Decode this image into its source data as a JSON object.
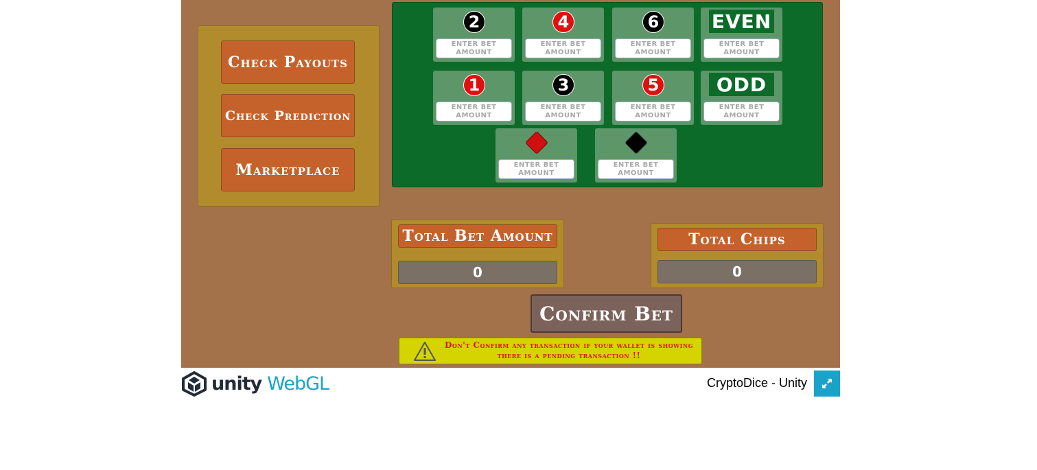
{
  "menu": {
    "check_payouts": "Check Payouts",
    "check_prediction": "Check Prediction",
    "marketplace": "Marketplace"
  },
  "board": {
    "bet_placeholder": "ENTER BET AMOUNT",
    "cells": [
      {
        "id": "2",
        "label": "2",
        "kind": "chip",
        "color": "black"
      },
      {
        "id": "4",
        "label": "4",
        "kind": "chip",
        "color": "red"
      },
      {
        "id": "6",
        "label": "6",
        "kind": "chip",
        "color": "black"
      },
      {
        "id": "even",
        "label": "EVEN",
        "kind": "text",
        "color": "green"
      },
      {
        "id": "1",
        "label": "1",
        "kind": "chip",
        "color": "red"
      },
      {
        "id": "3",
        "label": "3",
        "kind": "chip",
        "color": "black"
      },
      {
        "id": "5",
        "label": "5",
        "kind": "chip",
        "color": "red"
      },
      {
        "id": "odd",
        "label": "ODD",
        "kind": "text",
        "color": "green"
      },
      {
        "id": "red",
        "label": "",
        "kind": "diamond",
        "color": "red"
      },
      {
        "id": "black",
        "label": "",
        "kind": "diamond",
        "color": "black"
      }
    ]
  },
  "total_bet": {
    "title": "Total Bet Amount",
    "value": "0"
  },
  "total_chips": {
    "title": "Total Chips",
    "value": "0"
  },
  "confirm_label": "Confirm Bet",
  "warning": "Don't Confirm any transaction if your wallet is showing there is a pending transaction !!",
  "footer": {
    "unity": "unity",
    "webgl": "WebGL",
    "title": "CryptoDice - Unity"
  },
  "colors": {
    "background": "#a3714a",
    "board": "#0d6b2a",
    "button": "#c5622c",
    "panel": "#b28c2c",
    "warning": "#d4d400",
    "accent": "#1aa3c9"
  }
}
